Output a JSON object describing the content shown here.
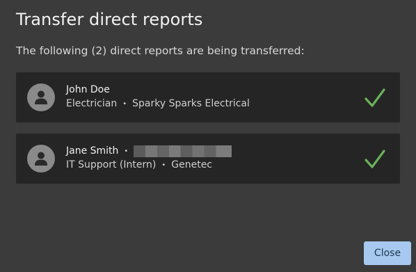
{
  "dialog": {
    "title": "Transfer direct reports",
    "subtitle": "The following (2) direct reports are being transferred:"
  },
  "reports": [
    {
      "name": "John Doe",
      "title": "Electrician",
      "company": "Sparky Sparks Electrical",
      "has_redacted_info": false,
      "status_icon": "checkmark-icon",
      "status_color": "#69b15a"
    },
    {
      "name": "Jane Smith",
      "title": "IT Support (Intern)",
      "company": "Genetec",
      "has_redacted_info": true,
      "status_icon": "checkmark-icon",
      "status_color": "#69b15a"
    }
  ],
  "separator": "•",
  "actions": {
    "close_label": "Close"
  },
  "colors": {
    "background": "#3b3b3b",
    "card": "#252525",
    "accent_button": "#a7c9ef",
    "check": "#69b15a"
  }
}
